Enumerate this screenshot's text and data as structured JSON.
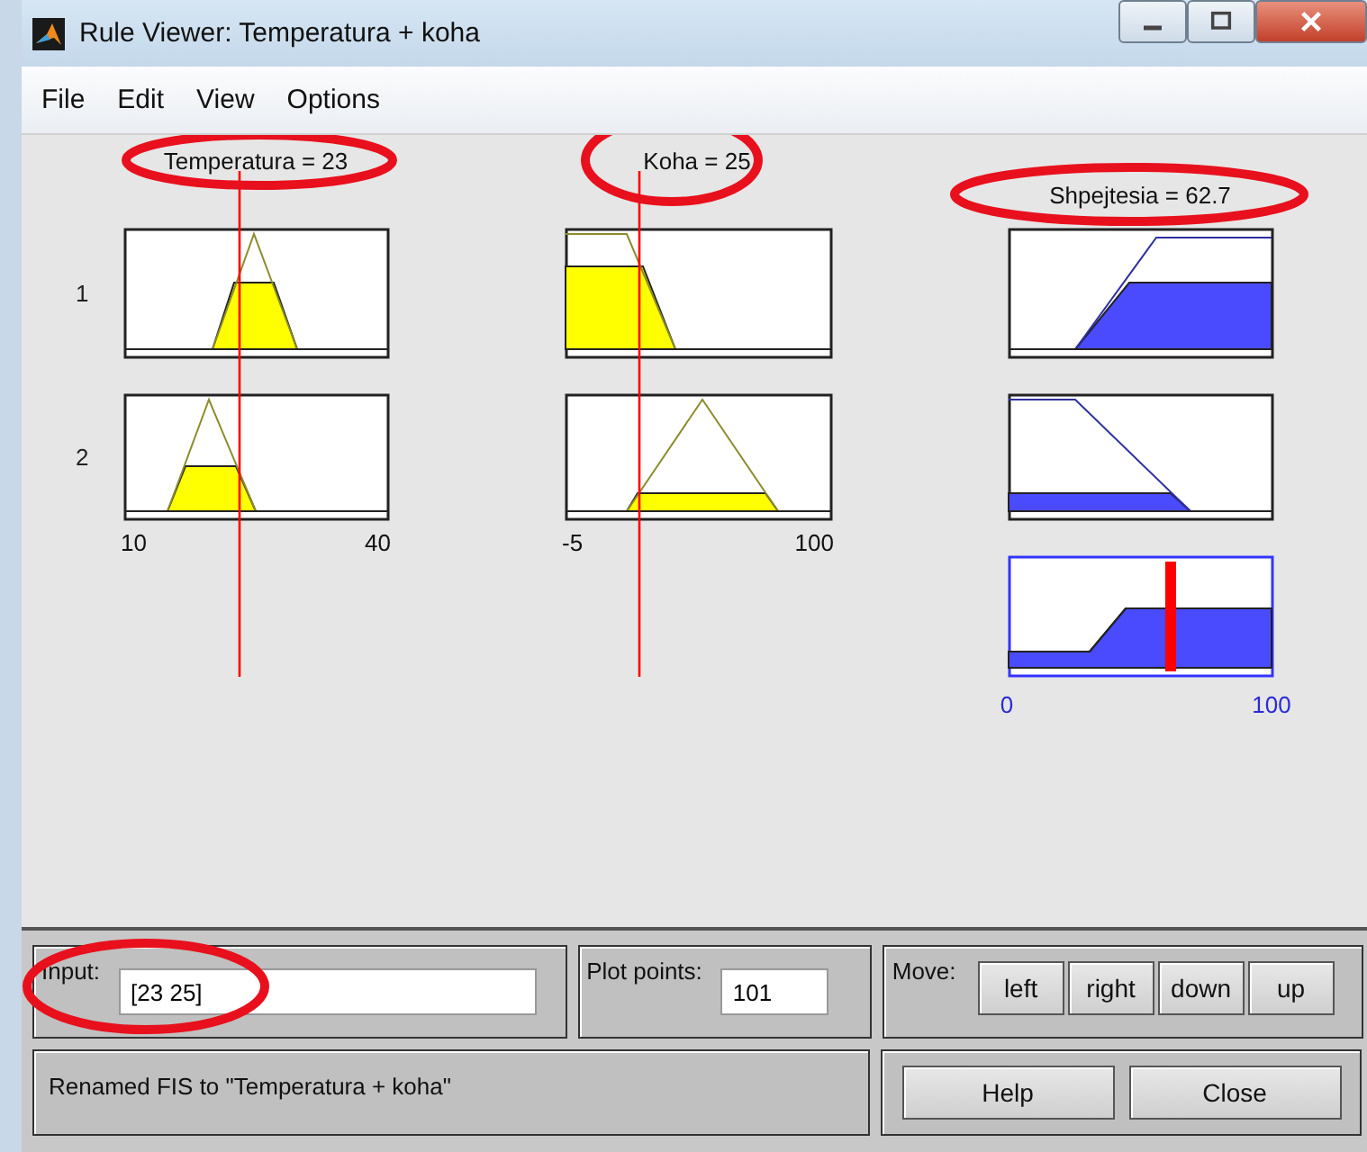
{
  "window": {
    "title": "Rule Viewer: Temperatura + koha"
  },
  "menu": [
    "File",
    "Edit",
    "View",
    "Options"
  ],
  "inputs": [
    {
      "label": "Temperatura = 23",
      "circled": true,
      "ticks": [
        "10",
        "40"
      ]
    },
    {
      "label": "Koha = 25",
      "circled": true,
      "ticks": [
        "-5",
        "100"
      ]
    }
  ],
  "output": {
    "label": "Shpejtesia = 62.7",
    "circled": true,
    "ticks": [
      "0",
      "100"
    ]
  },
  "rules": [
    "1",
    "2"
  ],
  "input_field": {
    "label": "Input:",
    "value": "[23 25]",
    "circled": true
  },
  "plot_points": {
    "label": "Plot points:",
    "value": "101"
  },
  "move": {
    "label": "Move:",
    "buttons": [
      "left",
      "right",
      "down",
      "up"
    ]
  },
  "status": "Renamed FIS to \"Temperatura + koha\"",
  "buttons": [
    "Help",
    "Close"
  ]
}
